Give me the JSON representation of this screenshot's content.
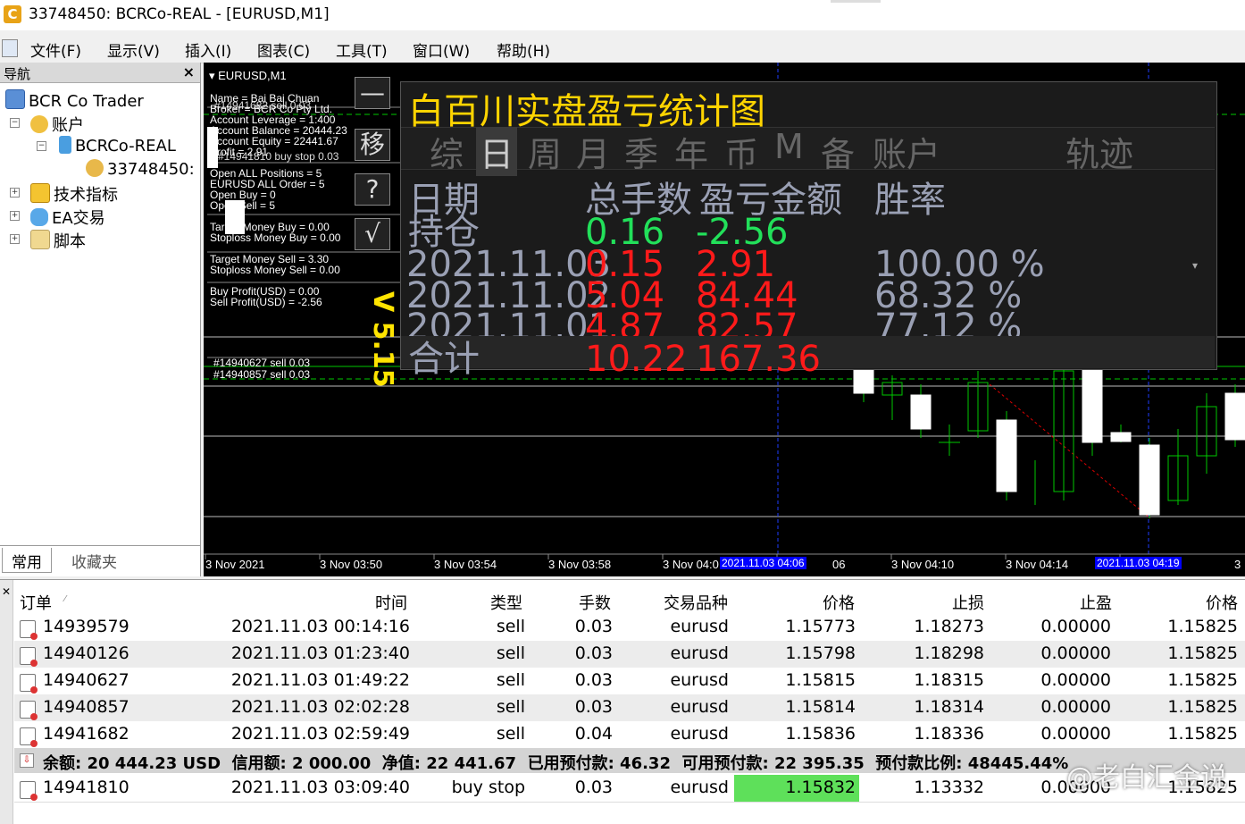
{
  "title": "33748450: BCRCo-REAL - [EURUSD,M1]",
  "menu": [
    "文件(F)",
    "显示(V)",
    "插入(I)",
    "图表(C)",
    "工具(T)",
    "窗口(W)",
    "帮助(H)"
  ],
  "nav": {
    "title": "导航",
    "close": "×",
    "items": [
      "BCR Co Trader",
      "账户",
      "BCRCo-REAL",
      "33748450:",
      "技术指标",
      "EA交易",
      "脚本"
    ],
    "tabs": [
      "常用",
      "收藏夹"
    ]
  },
  "chart": {
    "symbol_label": "EURUSD,M1",
    "info_lines": [
      "Name = Bai Bai Chuan",
      "Broker = BCR Co Pty Ltd.",
      "Account Leverage = 1:400",
      "Account Balance = 20444.23",
      "Account Equity = 22441.67",
      "Profit = 2.91",
      "#14941810 buy stop 0.03",
      "Open ALL Positions = 5",
      "EURUSD ALL Order = 5",
      "Open Buy = 0",
      "Open Sell = 5",
      "Target Money Buy = 0.00",
      "Stoploss Money Buy = 0.00",
      "Target Money Sell = 3.30",
      "Stoploss Money Sell = 0.00",
      "Buy Profit(USD) = 0.00",
      "Sell Profit(USD) = -2.56"
    ],
    "overlap_line": "#14941682 sell 0.03",
    "order_labels": [
      "#14940627 sell 0.03",
      "#14940857 sell 0.03"
    ],
    "buttons": [
      "—",
      "移",
      "?",
      "√"
    ],
    "version": "V 5.15",
    "x_labels": [
      "3 Nov 2021",
      "3 Nov 03:50",
      "3 Nov 03:54",
      "3 Nov 03:58",
      "3 Nov 04:0",
      "06",
      "3 Nov 04:10",
      "3 Nov 04:14",
      "3"
    ],
    "x_highlights": [
      "2021.11.03 04:06",
      "2021.11.03 04:19"
    ]
  },
  "stats": {
    "title": "白百川实盘盈亏统计图",
    "tabs": [
      "综",
      "日",
      "周",
      "月",
      "季",
      "年",
      "币",
      "M",
      "备",
      "账户",
      "轨迹"
    ],
    "headers": [
      "日期",
      "总手数",
      "盈亏金额",
      "胜率"
    ],
    "holding": {
      "label": "持仓",
      "lots": "0.16",
      "pnl": "-2.56"
    },
    "rows": [
      {
        "date": "2021.11.03",
        "lots": "0.15",
        "pnl": "2.91",
        "rate": "100.00 %"
      },
      {
        "date": "2021.11.02",
        "lots": "5.04",
        "pnl": "84.44",
        "rate": "68.32 %"
      },
      {
        "date": "2021.11.01",
        "lots": "4.87",
        "pnl": "82.57",
        "rate": "77.12 %"
      }
    ],
    "total": {
      "label": "合计",
      "lots": "10.22",
      "pnl": "167.36"
    },
    "colors": {
      "title": "#ffd400",
      "positive": "#ff1a1a",
      "holding": "#22e05a",
      "text": "#9aa0b4"
    }
  },
  "terminal": {
    "headers": [
      "订单",
      "时间",
      "类型",
      "手数",
      "交易品种",
      "价格",
      "止损",
      "止盈",
      "价格"
    ],
    "orders": [
      {
        "order": "14939579",
        "time": "2021.11.03 00:14:16",
        "type": "sell",
        "lots": "0.03",
        "symbol": "eurusd",
        "price": "1.15773",
        "sl": "1.18273",
        "tp": "0.00000",
        "cur": "1.15825"
      },
      {
        "order": "14940126",
        "time": "2021.11.03 01:23:40",
        "type": "sell",
        "lots": "0.03",
        "symbol": "eurusd",
        "price": "1.15798",
        "sl": "1.18298",
        "tp": "0.00000",
        "cur": "1.15825"
      },
      {
        "order": "14940627",
        "time": "2021.11.03 01:49:22",
        "type": "sell",
        "lots": "0.03",
        "symbol": "eurusd",
        "price": "1.15815",
        "sl": "1.18315",
        "tp": "0.00000",
        "cur": "1.15825"
      },
      {
        "order": "14940857",
        "time": "2021.11.03 02:02:28",
        "type": "sell",
        "lots": "0.03",
        "symbol": "eurusd",
        "price": "1.15814",
        "sl": "1.18314",
        "tp": "0.00000",
        "cur": "1.15825"
      },
      {
        "order": "14941682",
        "time": "2021.11.03 02:59:49",
        "type": "sell",
        "lots": "0.04",
        "symbol": "eurusd",
        "price": "1.15836",
        "sl": "1.18336",
        "tp": "0.00000",
        "cur": "1.15825"
      }
    ],
    "summary": "余额: 20 444.23 USD  信用额: 2 000.00  净值: 22 441.67  已用预付款: 46.32  可用预付款: 22 395.35  预付款比例: 48445.44%",
    "pending": {
      "order": "14941810",
      "time": "2021.11.03 03:09:40",
      "type": "buy stop",
      "lots": "0.03",
      "symbol": "eurusd",
      "price": "1.15832",
      "sl": "1.13332",
      "tp": "0.00000",
      "cur": "1.15825"
    },
    "watermark": "@老白汇金说"
  }
}
